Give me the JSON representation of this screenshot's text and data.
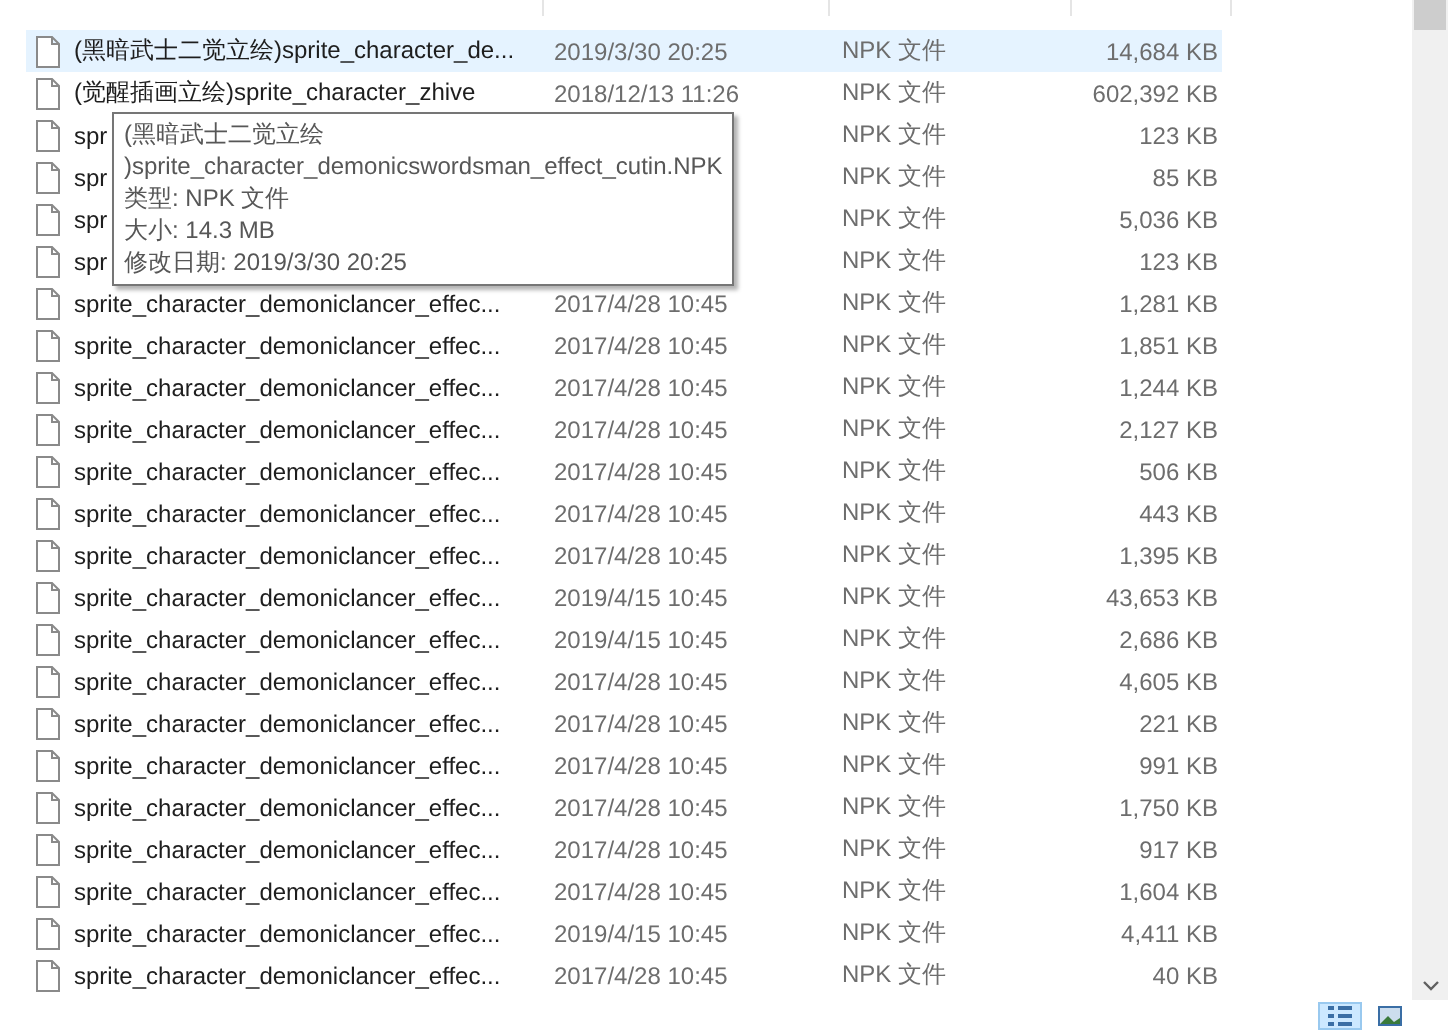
{
  "files": [
    {
      "name": "(黑暗武士二觉立绘)sprite_character_de...",
      "date": "2019/3/30 20:25",
      "type": "NPK 文件",
      "size": "14,684 KB",
      "selected": true
    },
    {
      "name": "(觉醒插画立绘)sprite_character_zhive",
      "date": "2018/12/13 11:26",
      "type": "NPK 文件",
      "size": "602,392 KB",
      "selected": false
    },
    {
      "name": "spr",
      "type": "NPK 文件",
      "size": "123 KB",
      "selected": false
    },
    {
      "name": "spr",
      "type": "NPK 文件",
      "size": "85 KB",
      "selected": false
    },
    {
      "name": "spr",
      "type": "NPK 文件",
      "size": "5,036 KB",
      "selected": false
    },
    {
      "name": "spr",
      "type": "NPK 文件",
      "size": "123 KB",
      "selected": false
    },
    {
      "name": "sprite_character_demoniclancer_effec...",
      "date": "2017/4/28 10:45",
      "type": "NPK 文件",
      "size": "1,281 KB",
      "selected": false
    },
    {
      "name": "sprite_character_demoniclancer_effec...",
      "date": "2017/4/28 10:45",
      "type": "NPK 文件",
      "size": "1,851 KB",
      "selected": false
    },
    {
      "name": "sprite_character_demoniclancer_effec...",
      "date": "2017/4/28 10:45",
      "type": "NPK 文件",
      "size": "1,244 KB",
      "selected": false
    },
    {
      "name": "sprite_character_demoniclancer_effec...",
      "date": "2017/4/28 10:45",
      "type": "NPK 文件",
      "size": "2,127 KB",
      "selected": false
    },
    {
      "name": "sprite_character_demoniclancer_effec...",
      "date": "2017/4/28 10:45",
      "type": "NPK 文件",
      "size": "506 KB",
      "selected": false
    },
    {
      "name": "sprite_character_demoniclancer_effec...",
      "date": "2017/4/28 10:45",
      "type": "NPK 文件",
      "size": "443 KB",
      "selected": false
    },
    {
      "name": "sprite_character_demoniclancer_effec...",
      "date": "2017/4/28 10:45",
      "type": "NPK 文件",
      "size": "1,395 KB",
      "selected": false
    },
    {
      "name": "sprite_character_demoniclancer_effec...",
      "date": "2019/4/15 10:45",
      "type": "NPK 文件",
      "size": "43,653 KB",
      "selected": false
    },
    {
      "name": "sprite_character_demoniclancer_effec...",
      "date": "2019/4/15 10:45",
      "type": "NPK 文件",
      "size": "2,686 KB",
      "selected": false
    },
    {
      "name": "sprite_character_demoniclancer_effec...",
      "date": "2017/4/28 10:45",
      "type": "NPK 文件",
      "size": "4,605 KB",
      "selected": false
    },
    {
      "name": "sprite_character_demoniclancer_effec...",
      "date": "2017/4/28 10:45",
      "type": "NPK 文件",
      "size": "221 KB",
      "selected": false
    },
    {
      "name": "sprite_character_demoniclancer_effec...",
      "date": "2017/4/28 10:45",
      "type": "NPK 文件",
      "size": "991 KB",
      "selected": false
    },
    {
      "name": "sprite_character_demoniclancer_effec...",
      "date": "2017/4/28 10:45",
      "type": "NPK 文件",
      "size": "1,750 KB",
      "selected": false
    },
    {
      "name": "sprite_character_demoniclancer_effec...",
      "date": "2017/4/28 10:45",
      "type": "NPK 文件",
      "size": "917 KB",
      "selected": false
    },
    {
      "name": "sprite_character_demoniclancer_effec...",
      "date": "2017/4/28 10:45",
      "type": "NPK 文件",
      "size": "1,604 KB",
      "selected": false
    },
    {
      "name": "sprite_character_demoniclancer_effec...",
      "date": "2019/4/15 10:45",
      "type": "NPK 文件",
      "size": "4,411 KB",
      "selected": false
    },
    {
      "name": "sprite_character_demoniclancer_effec...",
      "date": "2017/4/28 10:45",
      "type": "NPK 文件",
      "size": "40 KB",
      "selected": false
    }
  ],
  "tooltip": {
    "lines": [
      "(黑暗武士二觉立绘",
      ")sprite_character_demonicswordsman_effect_cutin.NPK",
      "类型: NPK 文件",
      "大小: 14.3 MB",
      "修改日期: 2019/3/30 20:25"
    ]
  },
  "view_buttons": [
    {
      "kind": "details",
      "selected": true
    },
    {
      "kind": "preview",
      "selected": false
    }
  ]
}
